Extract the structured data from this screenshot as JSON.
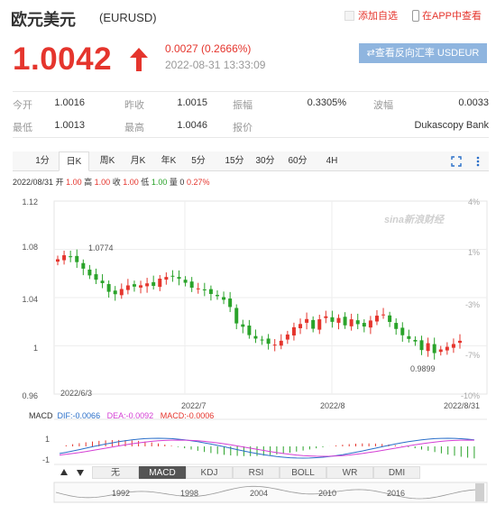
{
  "header": {
    "title": "欧元美元",
    "code": "(EURUSD)",
    "add_favorite": "添加自选",
    "app_link": "在APP中查看"
  },
  "quote": {
    "price": "1.0042",
    "change": "0.0027 (0.2666%)",
    "time": "2022-08-31 13:33:09",
    "reverse_button": "⇄查看反向汇率 USDEUR",
    "trend": "up",
    "accent_color": "#e5352d"
  },
  "stats": [
    {
      "label": "今开",
      "value": "1.0016"
    },
    {
      "label": "昨收",
      "value": "1.0015"
    },
    {
      "label": "振幅",
      "value": "0.3305%"
    },
    {
      "label": "波幅",
      "value": "0.0033"
    },
    {
      "label": "最低",
      "value": "1.0013"
    },
    {
      "label": "最高",
      "value": "1.0046"
    },
    {
      "label": "报价",
      "value": ""
    },
    {
      "label": "",
      "value": "Dukascopy Bank"
    }
  ],
  "tabs": [
    "1分",
    "日K",
    "周K",
    "月K",
    "年K",
    "5分",
    "15分",
    "30分",
    "60分",
    "4H"
  ],
  "active_tab": "日K",
  "ohlc": {
    "date": "2022/08/31",
    "open_label": "开",
    "open": "1.00",
    "high_label": "高",
    "high": "1.00",
    "close_label": "收",
    "close": "1.00",
    "low_label": "低",
    "low": "1.00",
    "volume_label": "量",
    "volume": "0",
    "change": "0.27%"
  },
  "chart_data": {
    "type": "candlestick",
    "y_ticks": [
      "1.12",
      "1.08",
      "1.04",
      "1",
      "0.96"
    ],
    "pct_ticks": [
      "4%",
      "1%",
      "-3%",
      "-7%",
      "-10%"
    ],
    "x_ticks": [
      "2022/6/3",
      "2022/7",
      "2022/8",
      "2022/8/31"
    ],
    "high_marker": "1.0774",
    "low_marker": "0.9899",
    "watermark": "sina新浪财经",
    "closes": [
      1.0718,
      1.0751,
      1.0735,
      1.0694,
      1.064,
      1.0584,
      1.0548,
      1.052,
      1.0448,
      1.0428,
      1.0471,
      1.0501,
      1.0491,
      1.0502,
      1.0518,
      1.0497,
      1.0557,
      1.0571,
      1.0579,
      1.0556,
      1.0523,
      1.0482,
      1.0476,
      1.046,
      1.043,
      1.0412,
      1.0382,
      1.0322,
      1.0186,
      1.0158,
      1.0089,
      1.006,
      1.005,
      1.0017,
      1.001,
      1.0042,
      1.0094,
      1.0154,
      1.0181,
      1.0222,
      1.0142,
      1.022,
      1.0245,
      1.0199,
      1.0231,
      1.017,
      1.022,
      1.018,
      1.016,
      1.021,
      1.025,
      1.026,
      1.0198,
      1.014,
      1.0088,
      1.0057,
      1.0036,
      0.9965,
      1.0022,
      0.994,
      0.997,
      0.9992,
      1.0015,
      1.0042
    ],
    "macd_label": "MACD",
    "dif_label": "DIF",
    "dif": "-0.0066",
    "dea_label": "DEA",
    "dea": "-0.0092",
    "macd_value_label": "MACD",
    "macd": "-0.0006",
    "macd_axis": [
      "1",
      "-1"
    ]
  },
  "indicators": [
    "无",
    "MACD",
    "KDJ",
    "RSI",
    "BOLL",
    "WR",
    "DMI"
  ],
  "active_indicator": "MACD",
  "timeline_years": [
    "1992",
    "1998",
    "2004",
    "2010",
    "2016"
  ]
}
